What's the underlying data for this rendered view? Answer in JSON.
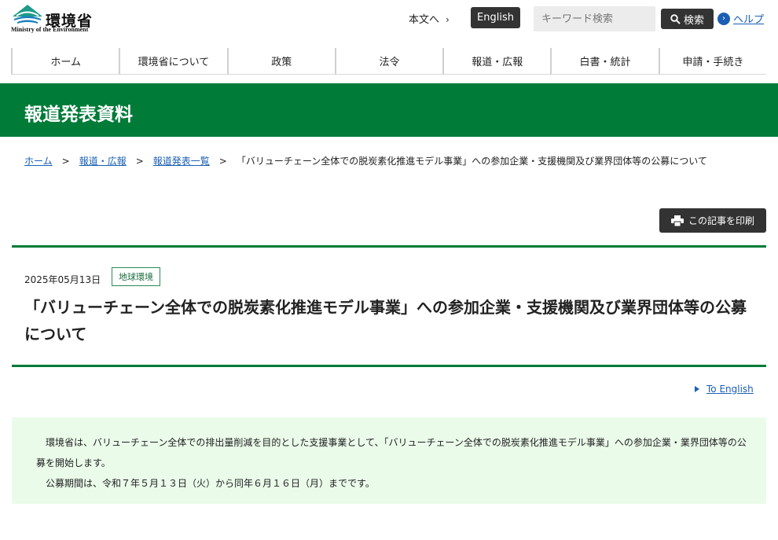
{
  "header": {
    "logo_text": "環境省",
    "logo_sub": "Ministry of the Environment",
    "honbun_label": "本文へ",
    "english_label": "English",
    "search_placeholder": "キーワード検索",
    "search_button_label": "検索",
    "help_label": "ヘルプ"
  },
  "nav": {
    "items": [
      {
        "label": "ホーム"
      },
      {
        "label": "環境省について"
      },
      {
        "label": "政策"
      },
      {
        "label": "法令"
      },
      {
        "label": "報道・広報"
      },
      {
        "label": "白書・統計"
      },
      {
        "label": "申請・手続き"
      }
    ]
  },
  "banner": {
    "title": "報道発表資料"
  },
  "breadcrumb": {
    "items": [
      {
        "label": "ホーム"
      },
      {
        "label": "報道・広報"
      },
      {
        "label": "報道発表一覧"
      }
    ],
    "separator": ">",
    "current": "「バリューチェーン全体での脱炭素化推進モデル事業」への参加企業・支援機関及び業界団体等の公募について"
  },
  "print_button_label": "この記事を印刷",
  "article": {
    "date": "2025年05月13日",
    "tag": "地球環境",
    "title": "「バリューチェーン全体での脱炭素化推進モデル事業」への参加企業・支援機関及び業界団体等の公募について",
    "to_english": "To English",
    "summary_p1": "環境省は、バリューチェーン全体での排出量削減を目的とした支援事業として、「バリューチェーン全体での脱炭素化推進モデル事業」への参加企業・業界団体等の公募を開始します。",
    "summary_p2": "公募期間は、令和７年５月１３日（火）から同年６月１６日（月）までです。"
  },
  "colors": {
    "brand_green": "#007b38",
    "link_blue": "#1a5fb4",
    "summary_bg": "#eafbea"
  }
}
